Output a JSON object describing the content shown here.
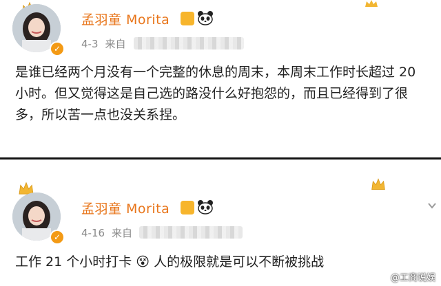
{
  "posts": [
    {
      "author": "孟羽童 Morita",
      "date": "4-3",
      "source_label": "来自",
      "content": "是谁已经两个月没有一个完整的休息的周末，本周末工作时长超过 20 小时。但又觉得这是自己选的路没什么好抱怨的，而且已经得到了很多，所以苦一点也没关系捏。"
    },
    {
      "author": "孟羽童 Morita",
      "date": "4-16",
      "source_label": "来自",
      "content": "工作 21 个小时打卡 😵 人的极限就是可以不断被挑战"
    }
  ],
  "watermark": "@工商说娱",
  "colors": {
    "name": "#e8751a",
    "meta": "#8a8a8a",
    "verify": "#f39a15",
    "crown": "#f2b632"
  },
  "icons": [
    "crown-icon",
    "verified-icon",
    "vip-badge-icon",
    "panda-icon",
    "chevron-down-icon"
  ]
}
